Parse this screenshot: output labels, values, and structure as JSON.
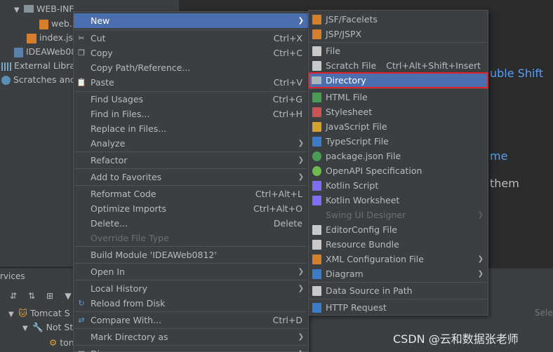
{
  "tree": {
    "items": [
      {
        "label": "WEB-INF",
        "type": "folder",
        "expanded": true
      },
      {
        "label": "web.x",
        "type": "xml"
      },
      {
        "label": "index.jsp",
        "type": "jsp"
      },
      {
        "label": "IDEAWeb08",
        "type": "iml"
      },
      {
        "label": "External Librar",
        "type": "library"
      },
      {
        "label": "Scratches and",
        "type": "scratches"
      }
    ]
  },
  "editor": {
    "hints": [
      "uble Shift",
      "me",
      "them"
    ]
  },
  "services": {
    "title": "rvices",
    "rows": [
      {
        "label": "Tomcat S"
      },
      {
        "label": "Not St"
      },
      {
        "label": "ton"
      }
    ],
    "select_hint": "Sele"
  },
  "watermark": "CSDN @云和数据张老师",
  "context_menu": {
    "items": [
      {
        "label": "New",
        "arrow": true,
        "selected": true
      },
      {
        "label": "Cut",
        "shortcut": "Ctrl+X",
        "icon": "scissors-icon"
      },
      {
        "label": "Copy",
        "shortcut": "Ctrl+C",
        "icon": "copy-icon"
      },
      {
        "label": "Copy Path/Reference..."
      },
      {
        "label": "Paste",
        "shortcut": "Ctrl+V",
        "icon": "paste-icon"
      },
      {
        "label": "Find Usages",
        "shortcut": "Ctrl+G"
      },
      {
        "label": "Find in Files...",
        "shortcut": "Ctrl+H"
      },
      {
        "label": "Replace in Files..."
      },
      {
        "label": "Analyze",
        "arrow": true
      },
      {
        "label": "Refactor",
        "arrow": true
      },
      {
        "label": "Add to Favorites",
        "arrow": true
      },
      {
        "label": "Reformat Code",
        "shortcut": "Ctrl+Alt+L"
      },
      {
        "label": "Optimize Imports",
        "shortcut": "Ctrl+Alt+O"
      },
      {
        "label": "Delete...",
        "shortcut": "Delete"
      },
      {
        "label": "Override File Type",
        "disabled": true
      },
      {
        "label": "Build Module 'IDEAWeb0812'"
      },
      {
        "label": "Open In",
        "arrow": true
      },
      {
        "label": "Local History",
        "arrow": true
      },
      {
        "label": "Reload from Disk",
        "icon": "reload-icon"
      },
      {
        "label": "Compare With...",
        "shortcut": "Ctrl+D",
        "icon": "compare-icon"
      },
      {
        "label": "Mark Directory as",
        "arrow": true
      },
      {
        "label": "Di",
        "arrow": true
      }
    ]
  },
  "new_submenu": {
    "items": [
      {
        "label": "JSF/Facelets",
        "icon": "jsf-icon",
        "color": "#d57f2c"
      },
      {
        "label": "JSP/JSPX",
        "icon": "jsp-icon",
        "color": "#d57f2c"
      },
      {
        "label": "File",
        "icon": "file-icon",
        "color": "#c9c9c9"
      },
      {
        "label": "Scratch File",
        "shortcut": "Ctrl+Alt+Shift+Insert",
        "icon": "scratch-file-icon",
        "color": "#c9c9c9"
      },
      {
        "label": "Directory",
        "icon": "folder-icon",
        "color": "#87939a",
        "highlighted": true
      },
      {
        "label": "HTML File",
        "icon": "html-icon",
        "color": "#499c54"
      },
      {
        "label": "Stylesheet",
        "icon": "css-icon",
        "color": "#c75450"
      },
      {
        "label": "JavaScript File",
        "icon": "js-icon",
        "color": "#d5a02c"
      },
      {
        "label": "TypeScript File",
        "icon": "ts-icon",
        "color": "#3d7cc9"
      },
      {
        "label": "package.json File",
        "icon": "npm-icon",
        "color": "#499c54"
      },
      {
        "label": "OpenAPI Specification",
        "icon": "openapi-icon",
        "color": "#6fba4c"
      },
      {
        "label": "Kotlin Script",
        "icon": "kotlin-icon",
        "color": "#7f6df2"
      },
      {
        "label": "Kotlin Worksheet",
        "icon": "kotlin-worksheet-icon",
        "color": "#7f6df2"
      },
      {
        "label": "Swing UI Designer",
        "arrow": true,
        "disabled": true
      },
      {
        "label": "EditorConfig File",
        "icon": "editorconfig-icon",
        "color": "#c9c9c9"
      },
      {
        "label": "Resource Bundle",
        "icon": "bundle-icon",
        "color": "#c9c9c9"
      },
      {
        "label": "XML Configuration File",
        "arrow": true,
        "icon": "xml-icon",
        "color": "#d57f2c"
      },
      {
        "label": "Diagram",
        "arrow": true,
        "icon": "diagram-icon",
        "color": "#3d7cc9"
      },
      {
        "label": "Data Source in Path",
        "icon": "database-icon",
        "color": "#c9c9c9"
      },
      {
        "label": "HTTP Request",
        "icon": "api-icon",
        "color": "#3d7cc9"
      }
    ]
  }
}
